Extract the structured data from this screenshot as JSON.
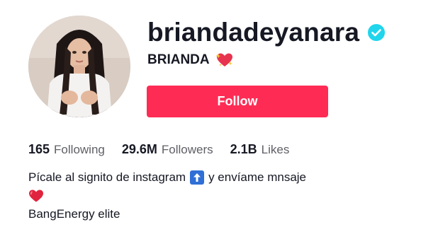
{
  "profile": {
    "username": "briandadeyanara",
    "nickname": "BRIANDA",
    "verified_icon": "verified-badge-icon",
    "nickname_emoji": "sparkling-heart-icon"
  },
  "actions": {
    "follow_label": "Follow"
  },
  "stats": {
    "following_count": "165",
    "following_label": "Following",
    "followers_count": "29.6M",
    "followers_label": "Followers",
    "likes_count": "2.1B",
    "likes_label": "Likes"
  },
  "bio": {
    "line1_before": "Pícale al signito de instagram",
    "line1_icon": "up-arrow-icon",
    "line1_after": "y envíame mnsaje",
    "line2_icon": "red-heart-icon",
    "line3": "BangEnergy elite"
  },
  "colors": {
    "follow_button": "#fe2c55",
    "verified_badge": "#20d5ec",
    "secondary_text": "#5e5f66",
    "primary_text": "#161823"
  }
}
